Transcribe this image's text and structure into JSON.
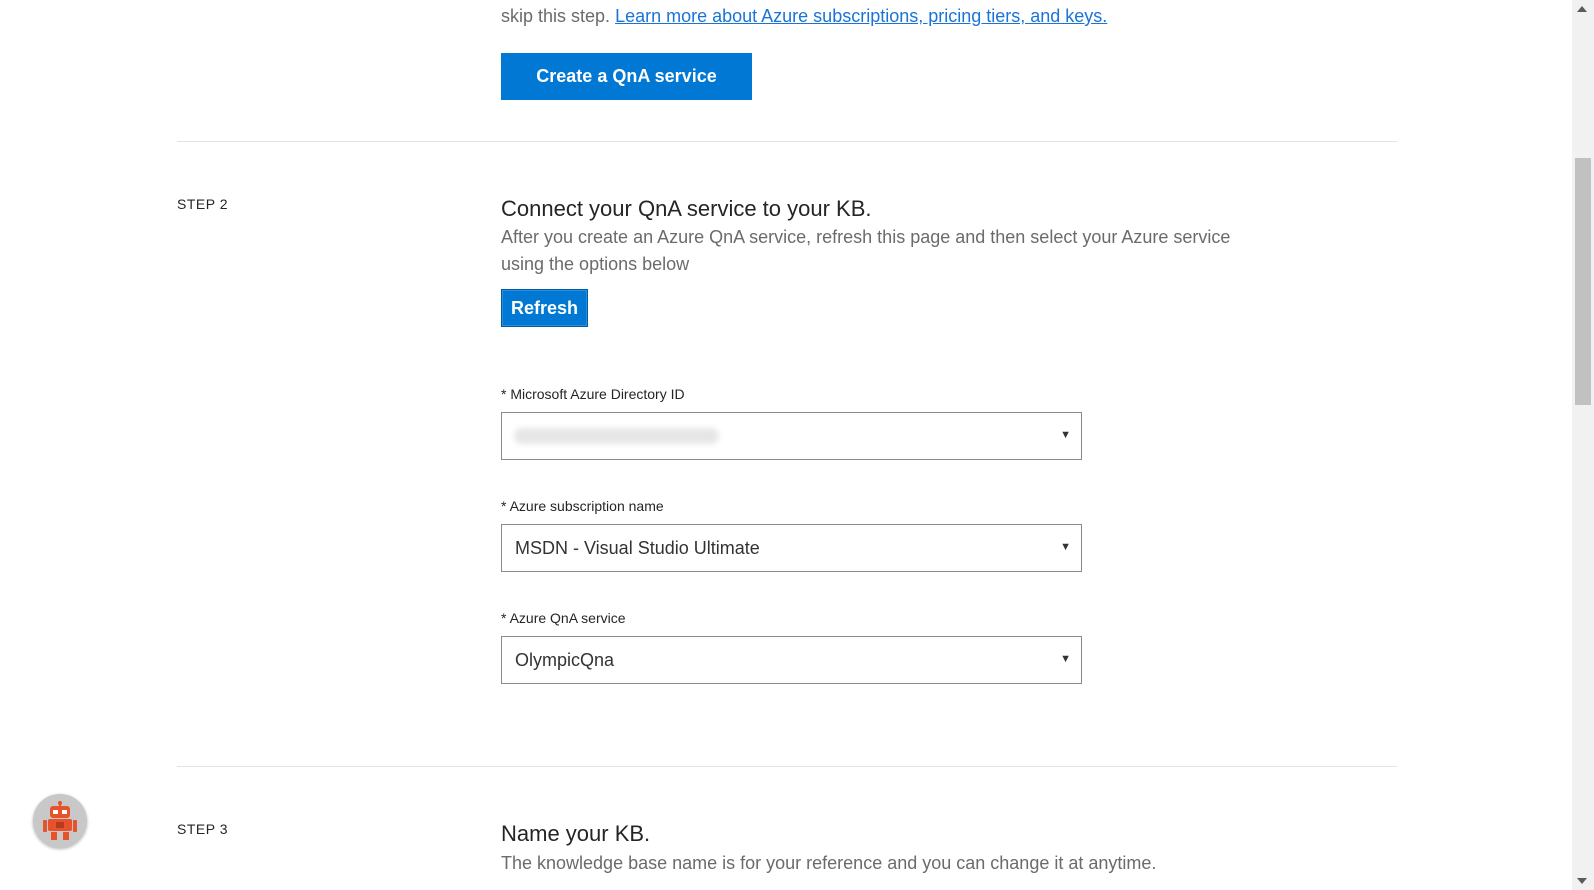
{
  "step1": {
    "intro_prefix": "skip this step.",
    "learn_more_link": "Learn more about Azure subscriptions, pricing tiers, and keys.",
    "create_button": "Create a QnA service"
  },
  "step2": {
    "label": "STEP 2",
    "title": "Connect your QnA service to your KB.",
    "description": "After you create an Azure QnA service, refresh this page and then select your Azure service using the options below",
    "refresh_button": "Refresh",
    "fields": [
      {
        "label": "* Microsoft Azure Directory ID",
        "value": ""
      },
      {
        "label": "* Azure subscription name",
        "value": "MSDN - Visual Studio Ultimate"
      },
      {
        "label": "* Azure QnA service",
        "value": "OlympicQna"
      }
    ],
    "caret_glyph": "▼"
  },
  "step3": {
    "label": "STEP 3",
    "title": "Name your KB.",
    "description": "The knowledge base name is for your reference and you can change it at anytime."
  },
  "icons": {
    "bot": "robot-icon",
    "caret": "caret-down-icon"
  },
  "colors": {
    "primary": "#0078d4",
    "link": "#1a73d9",
    "muted_text": "#6b6b6b",
    "bot_accent": "#e5522b"
  }
}
